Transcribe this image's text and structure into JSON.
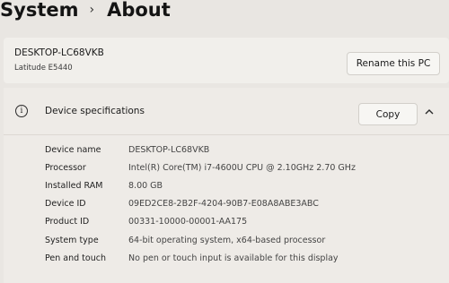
{
  "header": {
    "breadcrumb_root": "System",
    "separator": "›",
    "breadcrumb_current": "About"
  },
  "device_card": {
    "name": "DESKTOP-LC68VKB",
    "model": "Latitude E5440",
    "rename_label": "Rename this PC"
  },
  "specs": {
    "info_glyph": "i",
    "title": "Device specifications",
    "copy_label": "Copy",
    "rows": [
      {
        "label": "Device name",
        "value": "DESKTOP-LC68VKB"
      },
      {
        "label": "Processor",
        "value": "Intel(R) Core(TM) i7-4600U CPU @ 2.10GHz   2.70 GHz"
      },
      {
        "label": "Installed RAM",
        "value": "8.00 GB"
      },
      {
        "label": "Device ID",
        "value": "09ED2CE8-2B2F-4204-90B7-E08A8ABE3ABC"
      },
      {
        "label": "Product ID",
        "value": "00331-10000-00001-AA175"
      },
      {
        "label": "System type",
        "value": "64-bit operating system, x64-based processor"
      },
      {
        "label": "Pen and touch",
        "value": "No pen or touch input is available for this display"
      }
    ]
  },
  "icons": {
    "info": "info-circle-icon",
    "collapse": "chevron-up-icon",
    "breadcrumb_separator": "chevron-right-icon"
  }
}
